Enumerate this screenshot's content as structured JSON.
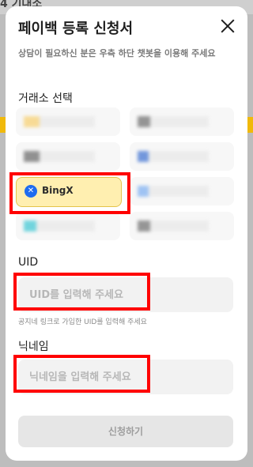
{
  "background": {
    "title_fragment": "4 기대소",
    "colors": {
      "overlay": "#bdbdbd",
      "accent": "#f0b90b"
    }
  },
  "modal": {
    "title": "페이백 등록 신청서",
    "close_icon": "close-icon",
    "description": "상담이 필요하신 분은 우측 하단 챗봇을 이용해 주세요",
    "exchange_section_label": "거래소 선택",
    "exchanges": [
      {
        "label": "",
        "blurred": true,
        "accent": "#f8cf6c"
      },
      {
        "label": "",
        "blurred": true,
        "accent": "#6b6b6b"
      },
      {
        "label": "",
        "blurred": true,
        "accent": "#666666"
      },
      {
        "label": "",
        "blurred": true,
        "accent": "#3a6fd1"
      },
      {
        "label": "BingX",
        "blurred": false,
        "selected": true,
        "icon": "bingx-icon",
        "accent": "#1e6cf0"
      },
      {
        "label": "",
        "blurred": true,
        "accent": "#7aaef2"
      },
      {
        "label": "",
        "blurred": true,
        "accent": "#39c6d3"
      },
      {
        "label": "",
        "blurred": true,
        "accent": "#6d6d6d"
      }
    ],
    "uid_label": "UID",
    "uid_placeholder": "UID를 입력해 주세요",
    "uid_note": "공지네 링크로 가입한 UID를 입력해 주세요",
    "nickname_label": "닉네임",
    "nickname_placeholder": "닉네임을 입력해 주세요",
    "submit_label": "신청하기",
    "highlight_color": "#ff0000"
  }
}
